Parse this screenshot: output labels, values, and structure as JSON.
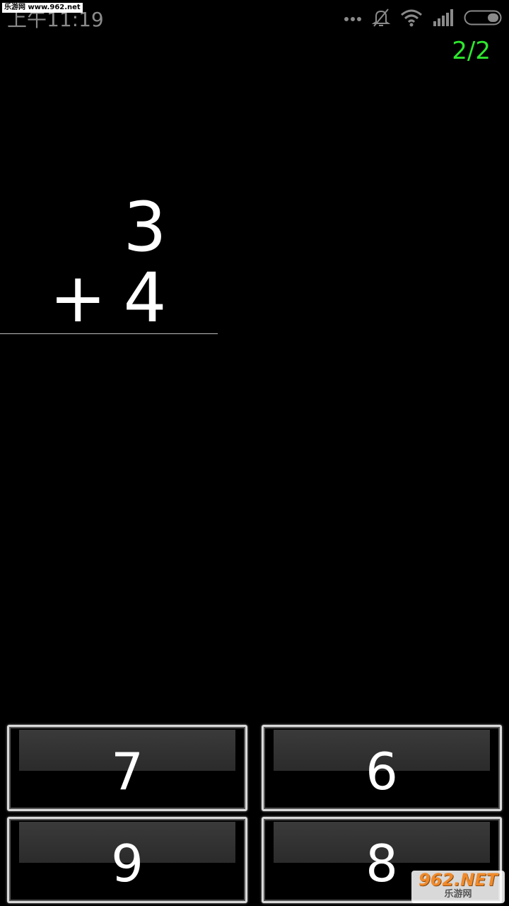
{
  "status_bar": {
    "time": "上午11:19",
    "watermark": "乐游网 www.962.net",
    "icons": [
      "more-dots-icon",
      "bell-off-icon",
      "wifi-icon",
      "signal-icon",
      "battery-icon"
    ]
  },
  "progress": {
    "counter": "2/2"
  },
  "problem": {
    "operand_a": "3",
    "operator": "+",
    "operand_b": "4"
  },
  "answers": [
    {
      "label": "7"
    },
    {
      "label": "6"
    },
    {
      "label": "9"
    },
    {
      "label": "8"
    }
  ],
  "watermark_bottom": {
    "brand": "962.NET",
    "sub": "乐游网"
  },
  "colors": {
    "background": "#000000",
    "counter": "#2ee82e",
    "text": "#ffffff"
  }
}
